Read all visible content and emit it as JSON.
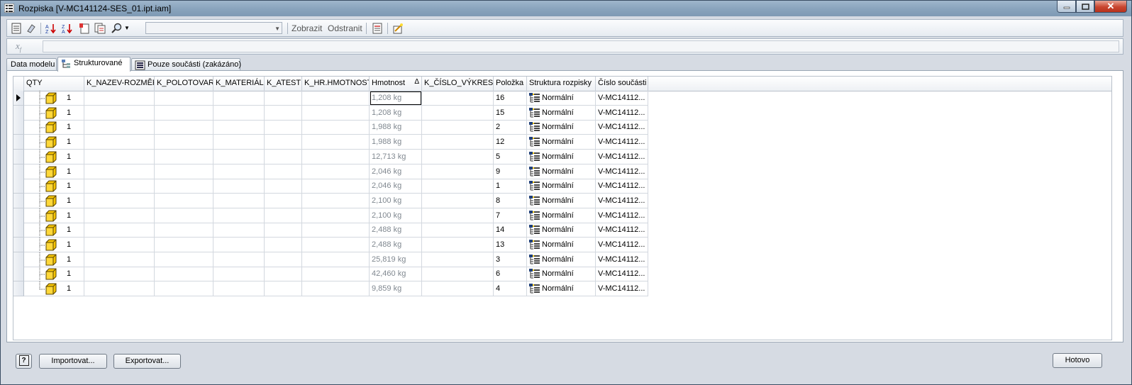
{
  "window": {
    "title": "Rozpiska [V-MC141124-SES_01.ipt.iam]"
  },
  "toolbar": {
    "combo_value": "",
    "show_label": "Zobrazit",
    "remove_label": "Odstranit"
  },
  "tabs": [
    {
      "label": "Data modelu",
      "active": false
    },
    {
      "label": "Strukturované",
      "active": true
    },
    {
      "label": "Pouze součásti (zakázáno)",
      "active": false
    }
  ],
  "grid": {
    "columns": [
      "QTY",
      "K_NAZEV-ROZMĚR",
      "K_POLOTOVAR",
      "K_MATERIÁL",
      "K_ATEST",
      "K_HR.HMOTNOST",
      "Hmotnost",
      "K_ČÍSLO_VÝKRESU",
      "Položka",
      "Struktura rozpisky",
      "Číslo součásti"
    ],
    "sort_indicator": "Δ",
    "rows": [
      {
        "qty": "1",
        "mass": "1,208 kg",
        "item": "16",
        "structure": "Normální",
        "part": "V-MC14112..."
      },
      {
        "qty": "1",
        "mass": "1,208 kg",
        "item": "15",
        "structure": "Normální",
        "part": "V-MC14112..."
      },
      {
        "qty": "1",
        "mass": "1,988 kg",
        "item": "2",
        "structure": "Normální",
        "part": "V-MC14112..."
      },
      {
        "qty": "1",
        "mass": "1,988 kg",
        "item": "12",
        "structure": "Normální",
        "part": "V-MC14112..."
      },
      {
        "qty": "1",
        "mass": "12,713 kg",
        "item": "5",
        "structure": "Normální",
        "part": "V-MC14112..."
      },
      {
        "qty": "1",
        "mass": "2,046 kg",
        "item": "9",
        "structure": "Normální",
        "part": "V-MC14112..."
      },
      {
        "qty": "1",
        "mass": "2,046 kg",
        "item": "1",
        "structure": "Normální",
        "part": "V-MC14112..."
      },
      {
        "qty": "1",
        "mass": "2,100 kg",
        "item": "8",
        "structure": "Normální",
        "part": "V-MC14112..."
      },
      {
        "qty": "1",
        "mass": "2,100 kg",
        "item": "7",
        "structure": "Normální",
        "part": "V-MC14112..."
      },
      {
        "qty": "1",
        "mass": "2,488 kg",
        "item": "14",
        "structure": "Normální",
        "part": "V-MC14112..."
      },
      {
        "qty": "1",
        "mass": "2,488 kg",
        "item": "13",
        "structure": "Normální",
        "part": "V-MC14112..."
      },
      {
        "qty": "1",
        "mass": "25,819 kg",
        "item": "3",
        "structure": "Normální",
        "part": "V-MC14112..."
      },
      {
        "qty": "1",
        "mass": "42,460 kg",
        "item": "6",
        "structure": "Normální",
        "part": "V-MC14112..."
      },
      {
        "qty": "1",
        "mass": "9,859 kg",
        "item": "4",
        "structure": "Normální",
        "part": "V-MC14112..."
      }
    ]
  },
  "buttons": {
    "help": "?",
    "import": "Importovat...",
    "export": "Exportovat...",
    "done": "Hotovo"
  },
  "colors": {
    "titlebar": "#8aa4bd",
    "close_button": "#c8452f",
    "part_cube": "#f5c400",
    "mass_text": "#808890"
  }
}
